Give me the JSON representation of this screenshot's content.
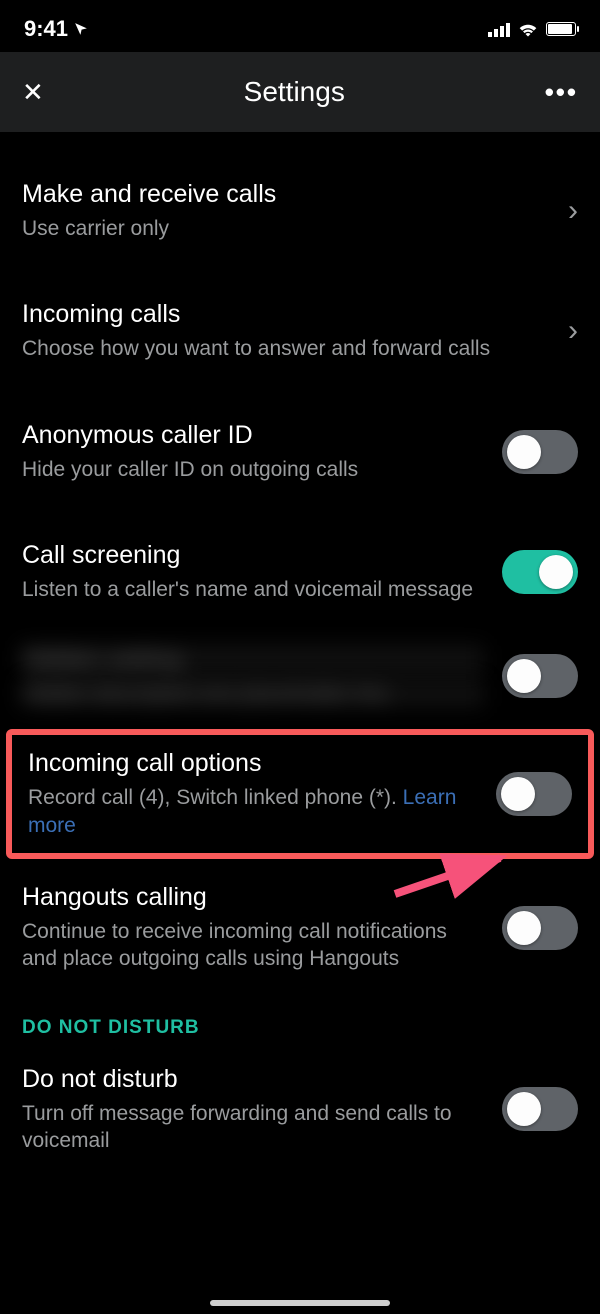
{
  "status": {
    "time": "9:41"
  },
  "header": {
    "title": "Settings",
    "close": "✕",
    "more": "•••"
  },
  "rows": {
    "make_calls": {
      "title": "Make and receive calls",
      "sub": "Use carrier only"
    },
    "incoming": {
      "title": "Incoming calls",
      "sub": "Choose how you want to answer and forward calls"
    },
    "anon": {
      "title": "Anonymous caller ID",
      "sub": "Hide your caller ID on outgoing calls"
    },
    "screening": {
      "title": "Call screening",
      "sub": "Listen to a caller's name and voicemail message"
    },
    "redacted": {
      "title": "Hidden setting",
      "sub": "Hidden description text placeholder line"
    },
    "ico": {
      "title": "Incoming call options",
      "sub": "Record call (4), Switch linked phone (*). ",
      "link": "Learn more"
    },
    "hangouts": {
      "title": "Hangouts calling",
      "sub": "Continue to receive incoming call notifications and place outgoing calls using Hangouts"
    },
    "dnd": {
      "title": "Do not disturb",
      "sub": "Turn off message forwarding and send calls to voicemail"
    }
  },
  "section": {
    "dnd": "DO NOT DISTURB"
  },
  "toggles": {
    "anon": false,
    "screening": true,
    "redacted": false,
    "ico": false,
    "hangouts": false,
    "dnd": false
  }
}
